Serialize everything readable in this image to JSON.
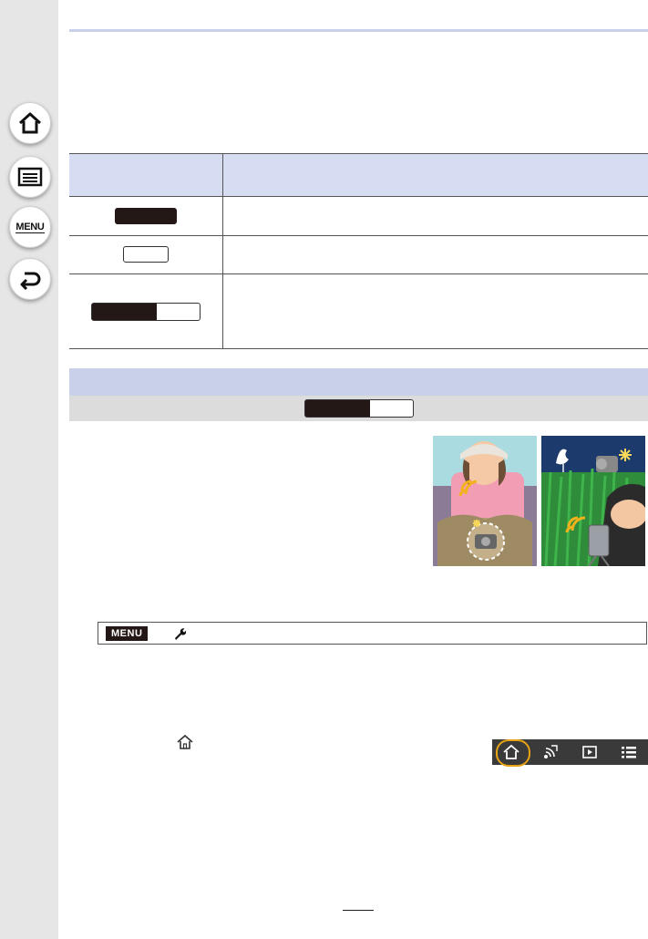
{
  "sidebar": {
    "items": [
      {
        "icon": "home-icon"
      },
      {
        "icon": "contents-list-icon"
      },
      {
        "icon": "menu-icon",
        "label": "MENU"
      },
      {
        "icon": "back-icon"
      }
    ]
  },
  "menu_path": {
    "badge": "MENU",
    "icon": "wrench-icon"
  },
  "tabbar": {
    "tabs": [
      {
        "icon": "home-icon",
        "selected": true
      },
      {
        "icon": "wireless-icon",
        "selected": false
      },
      {
        "icon": "playback-icon",
        "selected": false
      },
      {
        "icon": "list-icon",
        "selected": false
      }
    ],
    "accent": "#e8a316"
  },
  "colors": {
    "header_blue": "#c8d0ea",
    "table_header": "#d6ddf2",
    "sidebar": "#e6e6e6",
    "dark_fill": "#231815"
  }
}
